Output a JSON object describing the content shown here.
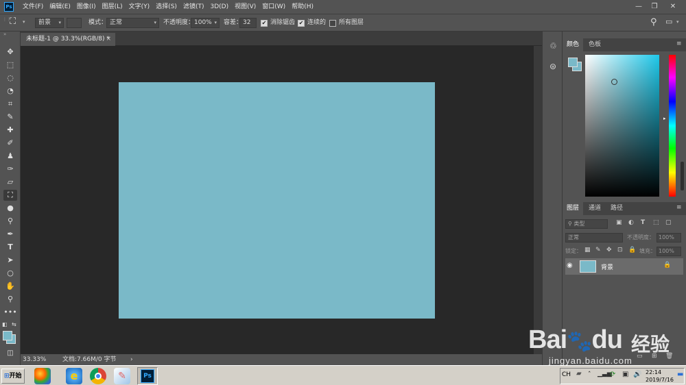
{
  "menubar": {
    "logo": "Ps",
    "items": [
      "文件(F)",
      "编辑(E)",
      "图像(I)",
      "图层(L)",
      "文字(Y)",
      "选择(S)",
      "滤镜(T)",
      "3D(D)",
      "视图(V)",
      "窗口(W)",
      "帮助(H)"
    ],
    "minimize": "—",
    "restore": "❐",
    "close": "✕"
  },
  "options": {
    "fill_source": "前景",
    "mode_label": "模式：",
    "mode_value": "正常",
    "opacity_label": "不透明度：",
    "opacity_value": "100%",
    "tolerance_label": "容差：",
    "tolerance_value": "32",
    "antialias_label": "消除锯齿",
    "contiguous_label": "连续的",
    "all_layers_label": "所有图层"
  },
  "document": {
    "tab_title": "未标题-1 @ 33.3%(RGB/8) *",
    "tab_close": "×",
    "canvas_color": "#7ab9c8"
  },
  "statusbar": {
    "zoom": "33.33%",
    "doc_info": "文档:7.66M/0 字节",
    "arrow": "›"
  },
  "color_panel": {
    "tabs": [
      "颜色",
      "色板"
    ],
    "foreground": "#7ab9c8",
    "background": "#7ab9c8"
  },
  "layers_panel": {
    "tabs": [
      "图层",
      "通道",
      "路径"
    ],
    "filter_label": "类型",
    "blend_mode": "正常",
    "opacity_label": "不透明度：",
    "opacity_value": "100%",
    "lock_label": "锁定：",
    "fill_label": "填充：",
    "fill_value": "100%",
    "layers": [
      {
        "name": "背景",
        "visible": true,
        "locked": true
      }
    ]
  },
  "taskbar": {
    "start_label": "开始",
    "lang": "CH",
    "time": "22:14",
    "date": "2019/7/16",
    "ps_label": "Ps"
  },
  "watermark": {
    "brand": "Bai",
    "brand2": "du",
    "suffix": "经验",
    "url": "jingyan.baidu.com"
  }
}
